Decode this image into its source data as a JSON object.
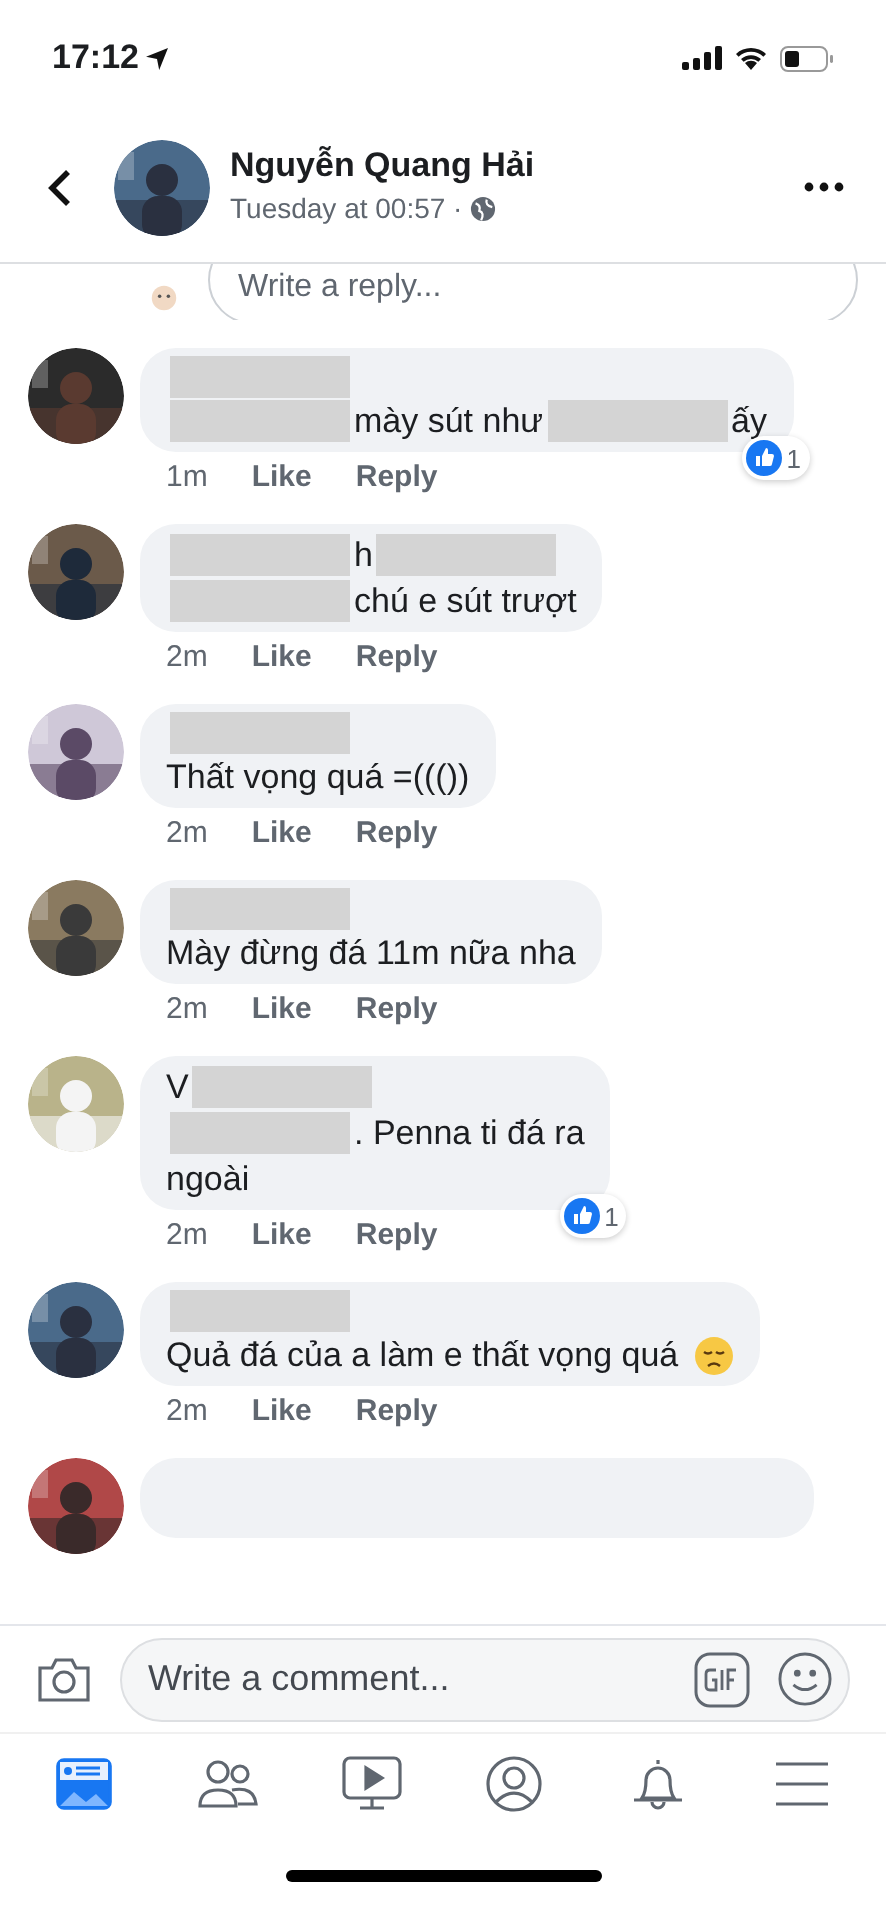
{
  "status_bar": {
    "time": "17:12"
  },
  "header": {
    "name": "Nguyễn Quang Hải",
    "subtitle": "Tuesday at 00:57 ·"
  },
  "reply_field": {
    "placeholder": "Write a reply..."
  },
  "comments": [
    {
      "kind": "full",
      "lines": [
        [
          {
            "kind": "redaction"
          }
        ],
        [
          {
            "kind": "redaction"
          },
          {
            "kind": "text",
            "text": "mày sút như"
          },
          {
            "kind": "redaction"
          },
          {
            "kind": "text",
            "text": "ấy"
          }
        ]
      ],
      "time": "1m",
      "like": "Like",
      "reply": "Reply",
      "reactions": "1"
    },
    {
      "kind": "full",
      "lines": [
        [
          {
            "kind": "redaction"
          },
          {
            "kind": "text",
            "text": "h"
          },
          {
            "kind": "redaction"
          }
        ],
        [
          {
            "kind": "redaction"
          },
          {
            "kind": "text",
            "text": "chú e sút trượt"
          }
        ]
      ],
      "time": "2m",
      "like": "Like",
      "reply": "Reply"
    },
    {
      "kind": "full",
      "lines": [
        [
          {
            "kind": "redaction"
          }
        ],
        [
          {
            "kind": "text",
            "text": "Thất vọng quá =((())"
          }
        ]
      ],
      "time": "2m",
      "like": "Like",
      "reply": "Reply"
    },
    {
      "kind": "full",
      "lines": [
        [
          {
            "kind": "redaction"
          }
        ],
        [
          {
            "kind": "text",
            "text": "Mày đừng đá 11m nữa nha"
          }
        ]
      ],
      "time": "2m",
      "like": "Like",
      "reply": "Reply"
    },
    {
      "kind": "full",
      "lines": [
        [
          {
            "kind": "text",
            "text": "V"
          },
          {
            "kind": "redaction"
          }
        ],
        [
          {
            "kind": "redaction"
          },
          {
            "kind": "text",
            "text": ". Penna ti đá ra"
          }
        ],
        [
          {
            "kind": "text",
            "text": "ngoài"
          }
        ]
      ],
      "time": "2m",
      "like": "Like",
      "reply": "Reply",
      "reactions": "1"
    },
    {
      "kind": "full",
      "lines": [
        [
          {
            "kind": "redaction"
          }
        ],
        [
          {
            "kind": "text",
            "text": "Quả đá của a làm e thất vọng quá"
          },
          {
            "kind": "emoji"
          }
        ]
      ],
      "time": "2m",
      "like": "Like",
      "reply": "Reply"
    },
    {
      "kind": "cut"
    }
  ],
  "composer": {
    "placeholder": "Write a comment..."
  },
  "tab_bar": [
    {
      "kind": "feed",
      "selected": true
    },
    {
      "kind": "friends",
      "selected": false
    },
    {
      "kind": "watch",
      "selected": false
    },
    {
      "kind": "profile",
      "selected": false
    },
    {
      "kind": "notifications",
      "selected": false
    },
    {
      "kind": "menu",
      "selected": false
    }
  ]
}
